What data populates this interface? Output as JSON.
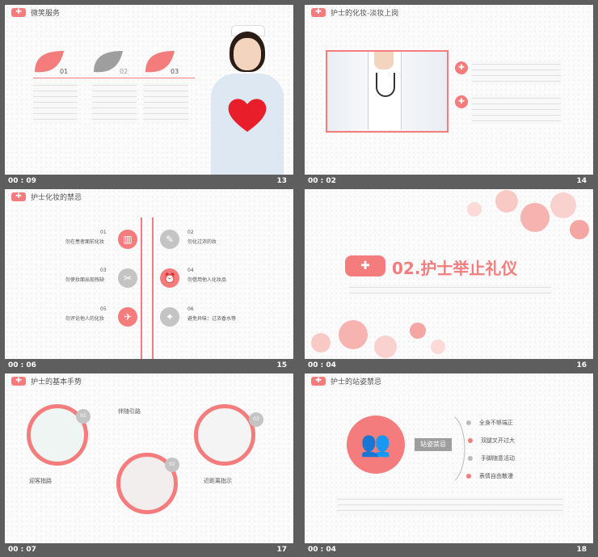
{
  "slides": [
    {
      "title": "微笑服务",
      "time": "00 : 09",
      "num": "13",
      "items": [
        {
          "n": "01"
        },
        {
          "n": "02"
        },
        {
          "n": "03"
        }
      ]
    },
    {
      "title": "护士的化妆-淡妆上岗",
      "time": "00 : 02",
      "num": "14"
    },
    {
      "title": "护士化妆的禁忌",
      "time": "00 : 06",
      "num": "15",
      "left": [
        {
          "n": "01",
          "t": "勿在患者面前化妆"
        },
        {
          "n": "03",
          "t": "勿使妆面出现残缺"
        },
        {
          "n": "05",
          "t": "勿评论他人的化妆"
        }
      ],
      "right": [
        {
          "n": "02",
          "t": "勿化过浓的妆"
        },
        {
          "n": "04",
          "t": "勿借用他人化妆品"
        },
        {
          "n": "06",
          "t": "避免异味：过浓香水等"
        }
      ]
    },
    {
      "title": "02.护士举止礼仪",
      "time": "00 : 04",
      "num": "16"
    },
    {
      "title": "护士的基本手势",
      "time": "00 : 07",
      "num": "17",
      "labels": {
        "a": "伴随引路",
        "b": "迎客指路",
        "c": "近距离指示"
      },
      "numbers": [
        "01",
        "02",
        "03"
      ]
    },
    {
      "title": "护士的站姿禁忌",
      "time": "00 : 04",
      "num": "18",
      "center": "站姿禁忌",
      "list": [
        "全身不够端正",
        "双腿叉开过大",
        "手脚随意活动",
        "表情自由散漫"
      ]
    }
  ],
  "colors": {
    "accent": "#f47c7c",
    "bg": "#5e5e5e"
  }
}
